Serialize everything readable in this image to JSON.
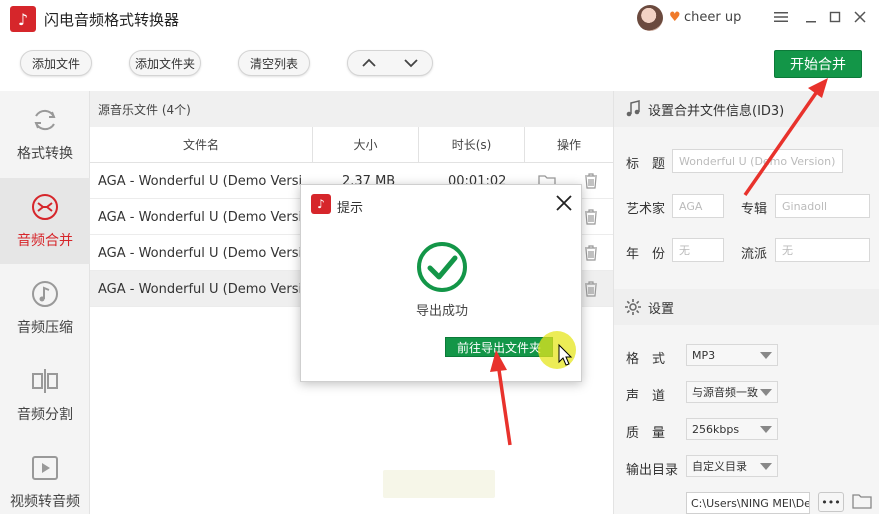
{
  "app": {
    "title": "闪电音频格式转换器",
    "logo_icon": "music-note-icon",
    "user_name": "cheer up",
    "accent_color": "#d6262b",
    "green_color": "#139648"
  },
  "toolbar": {
    "add_file": "添加文件",
    "add_folder": "添加文件夹",
    "clear_list": "清空列表",
    "start_merge": "开始合并"
  },
  "sidebar": {
    "items": [
      {
        "label": "格式转换",
        "icon": "refresh-icon"
      },
      {
        "label": "音频合并",
        "icon": "merge-icon"
      },
      {
        "label": "音频压缩",
        "icon": "music-disc-icon"
      },
      {
        "label": "音频分割",
        "icon": "split-icon"
      },
      {
        "label": "视频转音频",
        "icon": "play-icon"
      }
    ]
  },
  "list": {
    "header": "源音乐文件 (4个)",
    "columns": [
      "文件名",
      "大小",
      "时长(s)",
      "操作"
    ],
    "rows": [
      {
        "name": "AGA - Wonderful U (Demo Versi",
        "size": "2.37 MB",
        "duration": "00:01:02"
      },
      {
        "name": "AGA - Wonderful U (Demo Versi",
        "size": "",
        "duration": ""
      },
      {
        "name": "AGA - Wonderful U (Demo Versi",
        "size": "",
        "duration": ""
      },
      {
        "name": "AGA - Wonderful U (Demo Versi",
        "size": "",
        "duration": ""
      }
    ]
  },
  "id3": {
    "section_title": "设置合并文件信息(ID3)",
    "title_label": "标　题",
    "title_value": "Wonderful U (Demo Version)",
    "artist_label": "艺术家",
    "artist_value": "AGA",
    "album_label": "专辑",
    "album_value": "Ginadoll",
    "year_label": "年　份",
    "year_value": "无",
    "genre_label": "流派",
    "genre_value": "无"
  },
  "settings": {
    "section_title": "设置",
    "format_label": "格　式",
    "format_value": "MP3",
    "channel_label": "声　道",
    "channel_value": "与源音频一致",
    "quality_label": "质　量",
    "quality_value": "256kbps",
    "output_label": "输出目录",
    "output_value": "自定义目录",
    "path_value": "C:\\Users\\NING MEI\\De",
    "browse_label": "•••"
  },
  "dialog": {
    "title": "提示",
    "message": "导出成功",
    "open_folder": "前往导出文件夹"
  }
}
